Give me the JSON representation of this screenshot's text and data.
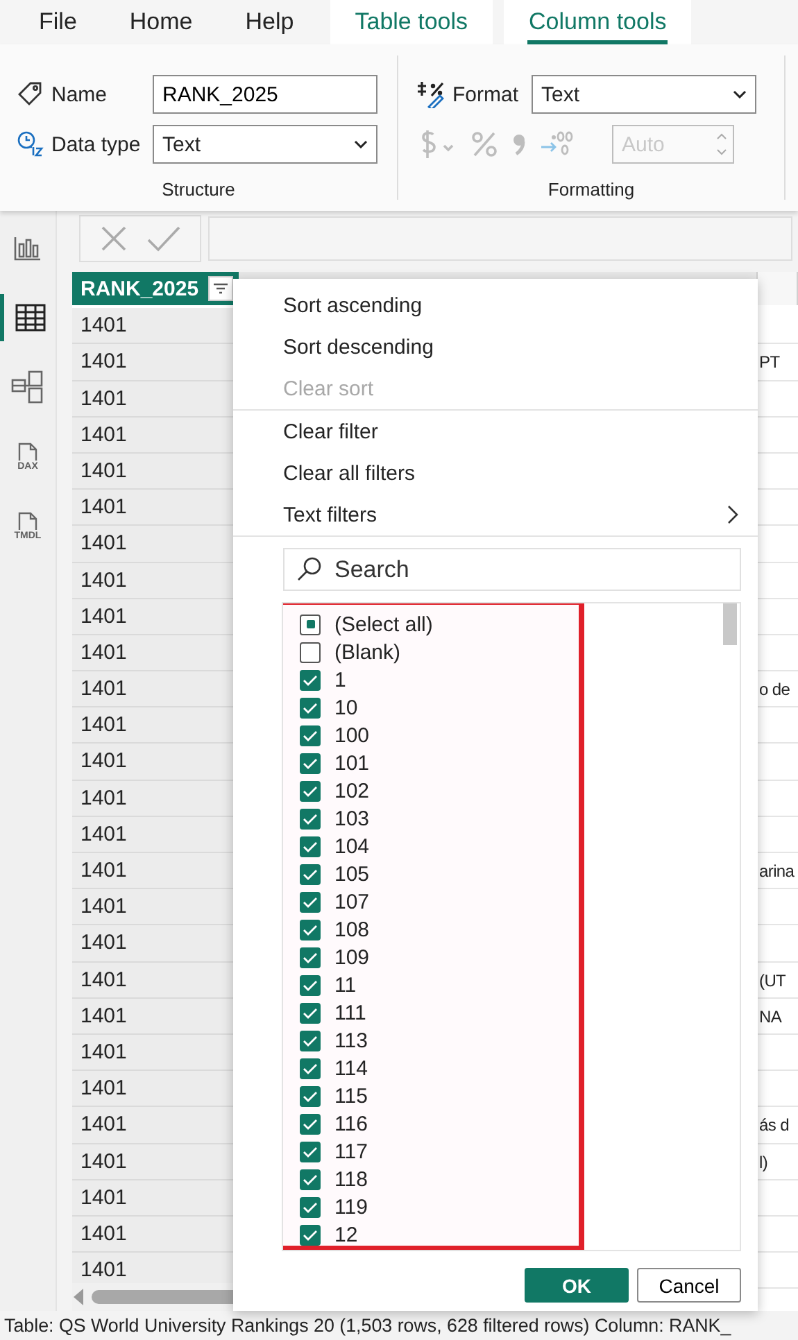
{
  "menu_tabs": [
    {
      "label": "File",
      "kind": "plain",
      "selected": false
    },
    {
      "label": "Home",
      "kind": "plain",
      "selected": false
    },
    {
      "label": "Help",
      "kind": "plain",
      "selected": false
    },
    {
      "label": "Table tools",
      "kind": "context",
      "selected": false
    },
    {
      "label": "Column tools",
      "kind": "context",
      "selected": true
    }
  ],
  "ribbon": {
    "structure": {
      "name_label": "Name",
      "name_value": "RANK_2025",
      "data_type_label": "Data type",
      "data_type_value": "Text",
      "group_label": "Structure"
    },
    "formatting": {
      "format_label": "Format",
      "format_value": "Text",
      "decimals_placeholder": "Auto",
      "group_label": "Formatting"
    }
  },
  "sidebar": [
    {
      "kind": "report",
      "selected": false
    },
    {
      "kind": "table",
      "selected": true
    },
    {
      "kind": "model",
      "selected": false
    },
    {
      "kind": "file",
      "label": "DAX",
      "selected": false
    },
    {
      "kind": "file",
      "label": "TMDL",
      "selected": false
    }
  ],
  "table": {
    "rank_header": "RANK_2025",
    "rows": [
      {
        "rank": "1401"
      },
      {
        "rank": "1401",
        "column_3": "PT"
      },
      {
        "rank": "1401"
      },
      {
        "rank": "1401"
      },
      {
        "rank": "1401"
      },
      {
        "rank": "1401"
      },
      {
        "rank": "1401"
      },
      {
        "rank": "1401"
      },
      {
        "rank": "1401"
      },
      {
        "rank": "1401"
      },
      {
        "rank": "1401",
        "column_3": "o de"
      },
      {
        "rank": "1401"
      },
      {
        "rank": "1401"
      },
      {
        "rank": "1401"
      },
      {
        "rank": "1401"
      },
      {
        "rank": "1401",
        "column_3": "arina"
      },
      {
        "rank": "1401"
      },
      {
        "rank": "1401"
      },
      {
        "rank": "1401",
        "column_3": "(UT"
      },
      {
        "rank": "1401",
        "column_3": "NA"
      },
      {
        "rank": "1401"
      },
      {
        "rank": "1401"
      },
      {
        "rank": "1401",
        "column_3": "ás d"
      },
      {
        "rank": "1401",
        "column_3": "l)"
      },
      {
        "rank": "1401"
      },
      {
        "rank": "1401"
      },
      {
        "rank": "1401"
      }
    ]
  },
  "filter_menu": {
    "items": [
      {
        "label": "Sort ascending",
        "disabled": false,
        "submenu": false,
        "divider_after": false
      },
      {
        "label": "Sort descending",
        "disabled": false,
        "submenu": false,
        "divider_after": false
      },
      {
        "label": "Clear sort",
        "disabled": true,
        "submenu": false,
        "divider_after": true
      },
      {
        "label": "Clear filter",
        "disabled": false,
        "submenu": false,
        "divider_after": false
      },
      {
        "label": "Clear all filters",
        "disabled": false,
        "submenu": false,
        "divider_after": false
      },
      {
        "label": "Text filters",
        "disabled": false,
        "submenu": true,
        "divider_after": true
      }
    ],
    "search": {
      "placeholder": "Search"
    },
    "select_all": {
      "label": "(Select all)",
      "mixed": true
    },
    "values": [
      {
        "label": "(Blank)",
        "checked": false
      },
      {
        "label": "1",
        "checked": true
      },
      {
        "label": "10",
        "checked": true
      },
      {
        "label": "100",
        "checked": true
      },
      {
        "label": "101",
        "checked": true
      },
      {
        "label": "102",
        "checked": true
      },
      {
        "label": "103",
        "checked": true
      },
      {
        "label": "104",
        "checked": true
      },
      {
        "label": "105",
        "checked": true
      },
      {
        "label": "107",
        "checked": true
      },
      {
        "label": "108",
        "checked": true
      },
      {
        "label": "109",
        "checked": true
      },
      {
        "label": "11",
        "checked": true
      },
      {
        "label": "111",
        "checked": true
      },
      {
        "label": "113",
        "checked": true
      },
      {
        "label": "114",
        "checked": true
      },
      {
        "label": "115",
        "checked": true
      },
      {
        "label": "116",
        "checked": true
      },
      {
        "label": "117",
        "checked": true
      },
      {
        "label": "118",
        "checked": true
      },
      {
        "label": "119",
        "checked": true
      },
      {
        "label": "12",
        "checked": true
      }
    ],
    "buttons": [
      {
        "label": "OK",
        "kind": "primary"
      },
      {
        "label": "Cancel",
        "kind": "secondary"
      }
    ]
  },
  "status_bar": "Table: QS World University Rankings 20 (1,503 rows, 628 filtered rows) Column: RANK_"
}
